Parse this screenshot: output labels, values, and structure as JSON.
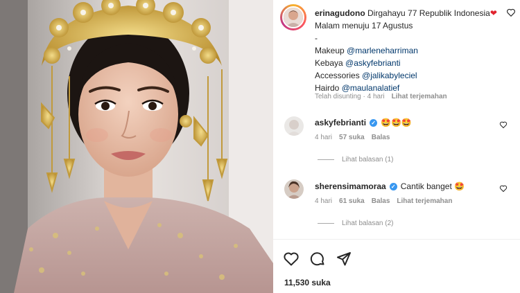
{
  "post": {
    "author": "erinagudono",
    "caption_line1": "Dirgahayu 77 Republik Indonesia",
    "caption_emoji": "❤",
    "caption_line2": "Malam menuju 17 Agustus",
    "caption_dash": "-",
    "credits": [
      {
        "label": "Makeup",
        "handle": "@marleneharriman"
      },
      {
        "label": "Kebaya",
        "handle": "@askyfebrianti"
      },
      {
        "label": "Accessories",
        "handle": "@jalikabyleciel"
      },
      {
        "label": "Hairdo",
        "handle": "@maulanalatief"
      }
    ],
    "edited_label": "Telah disunting · 4 hari",
    "translate_label": "Lihat terjemahan",
    "likes": "11,530 suka"
  },
  "comments": [
    {
      "username": "askyfebrianti",
      "text": "🤩🤩🤩",
      "time": "4 hari",
      "likes": "57 suka",
      "reply_label": "Balas",
      "view_replies": "Lihat balasan (1)"
    },
    {
      "username": "sherensimamoraa",
      "text": "Cantik banget 🤩",
      "time": "4 hari",
      "likes": "61 suka",
      "reply_label": "Balas",
      "translate_label": "Lihat terjemahan",
      "view_replies": "Lihat balasan (2)"
    }
  ],
  "colors": {
    "link": "#00376b",
    "verified": "#3897f0",
    "muted": "#8e8e8e",
    "heart": "#e0242f"
  },
  "icons": [
    "heart-icon",
    "comment-icon",
    "share-icon",
    "verified-icon",
    "avatar"
  ]
}
